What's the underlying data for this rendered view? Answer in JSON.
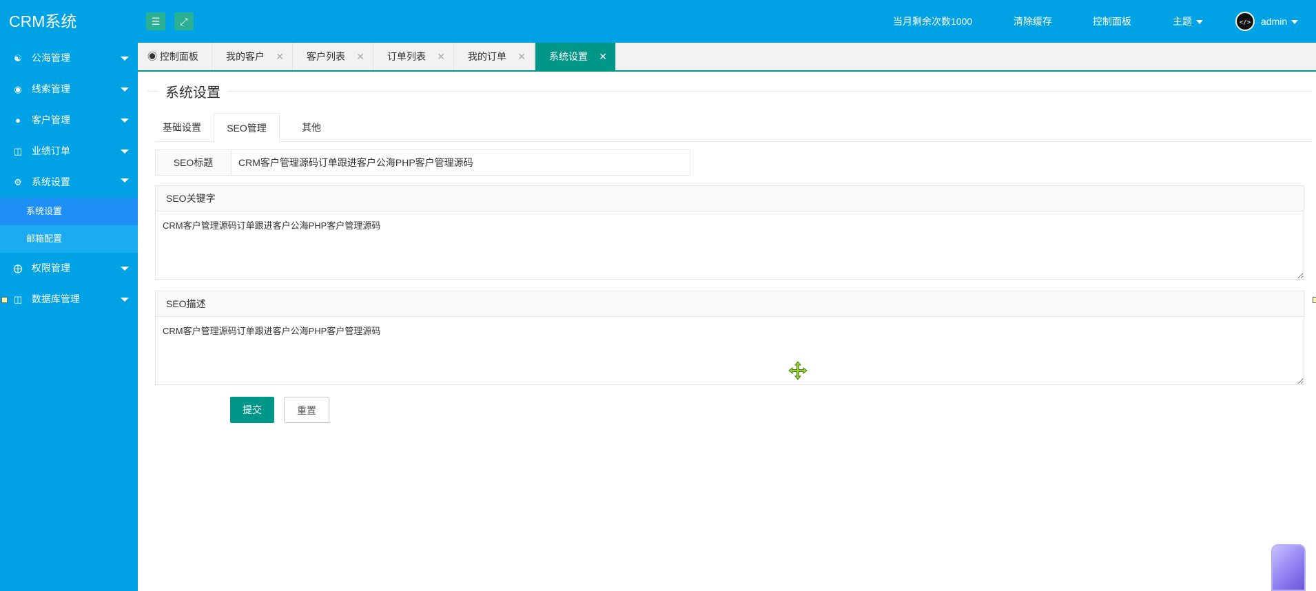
{
  "app": {
    "logo": "CRM系统"
  },
  "header": {
    "remaining": "当月剩余次数1000",
    "clear_cache": "清除缓存",
    "dashboard": "控制面板",
    "theme": "主题",
    "user": "admin",
    "avatar_text": "</>"
  },
  "sidebar": {
    "items": [
      {
        "label": "公海管理",
        "icon": "users-icon"
      },
      {
        "label": "线索管理",
        "icon": "globe-icon"
      },
      {
        "label": "客户管理",
        "icon": "user-icon"
      },
      {
        "label": "业绩订单",
        "icon": "database-icon"
      },
      {
        "label": "系统设置",
        "icon": "gear-icon"
      },
      {
        "label": "权限管理",
        "icon": "lifebuoy-icon"
      },
      {
        "label": "数据库管理",
        "icon": "database-icon"
      }
    ],
    "subitems": [
      {
        "label": "系统设置"
      },
      {
        "label": "邮箱配置"
      }
    ]
  },
  "tabs": [
    {
      "label": "控制面板"
    },
    {
      "label": "我的客户"
    },
    {
      "label": "客户列表"
    },
    {
      "label": "订单列表"
    },
    {
      "label": "我的订单"
    },
    {
      "label": "系统设置"
    }
  ],
  "page": {
    "legend": "系统设置",
    "subtabs": [
      {
        "label": "基础设置"
      },
      {
        "label": "SEO管理"
      },
      {
        "label": "其他"
      }
    ],
    "seo_title_label": "SEO标题",
    "seo_title_value": "CRM客户管理源码订单跟进客户公海PHP客户管理源码",
    "seo_keywords_label": "SEO关键字",
    "seo_keywords_value": "CRM客户管理源码订单跟进客户公海PHP客户管理源码",
    "seo_desc_label": "SEO描述",
    "seo_desc_value": "CRM客户管理源码订单跟进客户公海PHP客户管理源码",
    "submit": "提交",
    "reset": "重置"
  },
  "colors": {
    "primary": "#00a2e6",
    "accent": "#009688"
  }
}
